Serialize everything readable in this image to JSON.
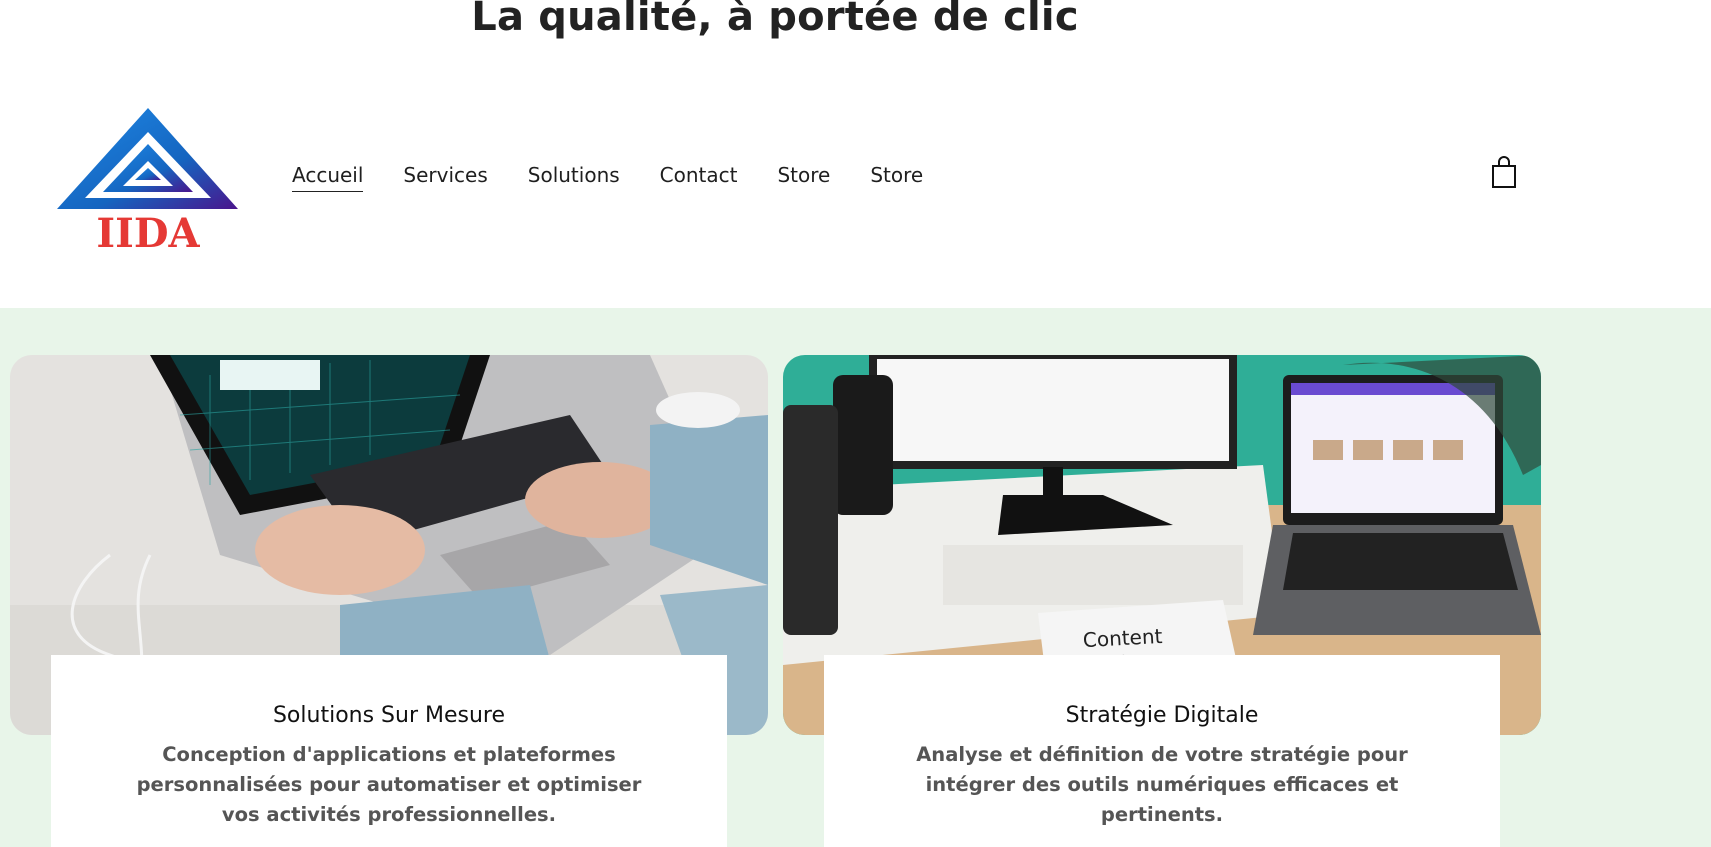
{
  "headline": "La qualité, à portée de clic",
  "logo": {
    "text": "IIDA",
    "icon": "triangle-logo-icon"
  },
  "nav": {
    "items": [
      {
        "label": "Accueil",
        "active": true
      },
      {
        "label": "Services",
        "active": false
      },
      {
        "label": "Solutions",
        "active": false
      },
      {
        "label": "Contact",
        "active": false
      },
      {
        "label": "Store",
        "active": false
      },
      {
        "label": "Store",
        "active": false
      }
    ]
  },
  "cart": {
    "icon": "shopping-bag-icon"
  },
  "cards": [
    {
      "title": "Solutions Sur Mesure",
      "description": "Conception d'applications et plateformes personnalisées pour automatiser et optimiser vos activités professionnelles."
    },
    {
      "title": "Stratégie Digitale",
      "description": "Analyse et définition de votre stratégie pour intégrer des outils numériques efficaces et pertinents.",
      "photo_sign_text": "Content Strategy"
    }
  ],
  "colors": {
    "content_bg": "#e8f5e9",
    "logo_blue": "#1565c0",
    "logo_purple": "#4a148c",
    "logo_red": "#e53935"
  }
}
